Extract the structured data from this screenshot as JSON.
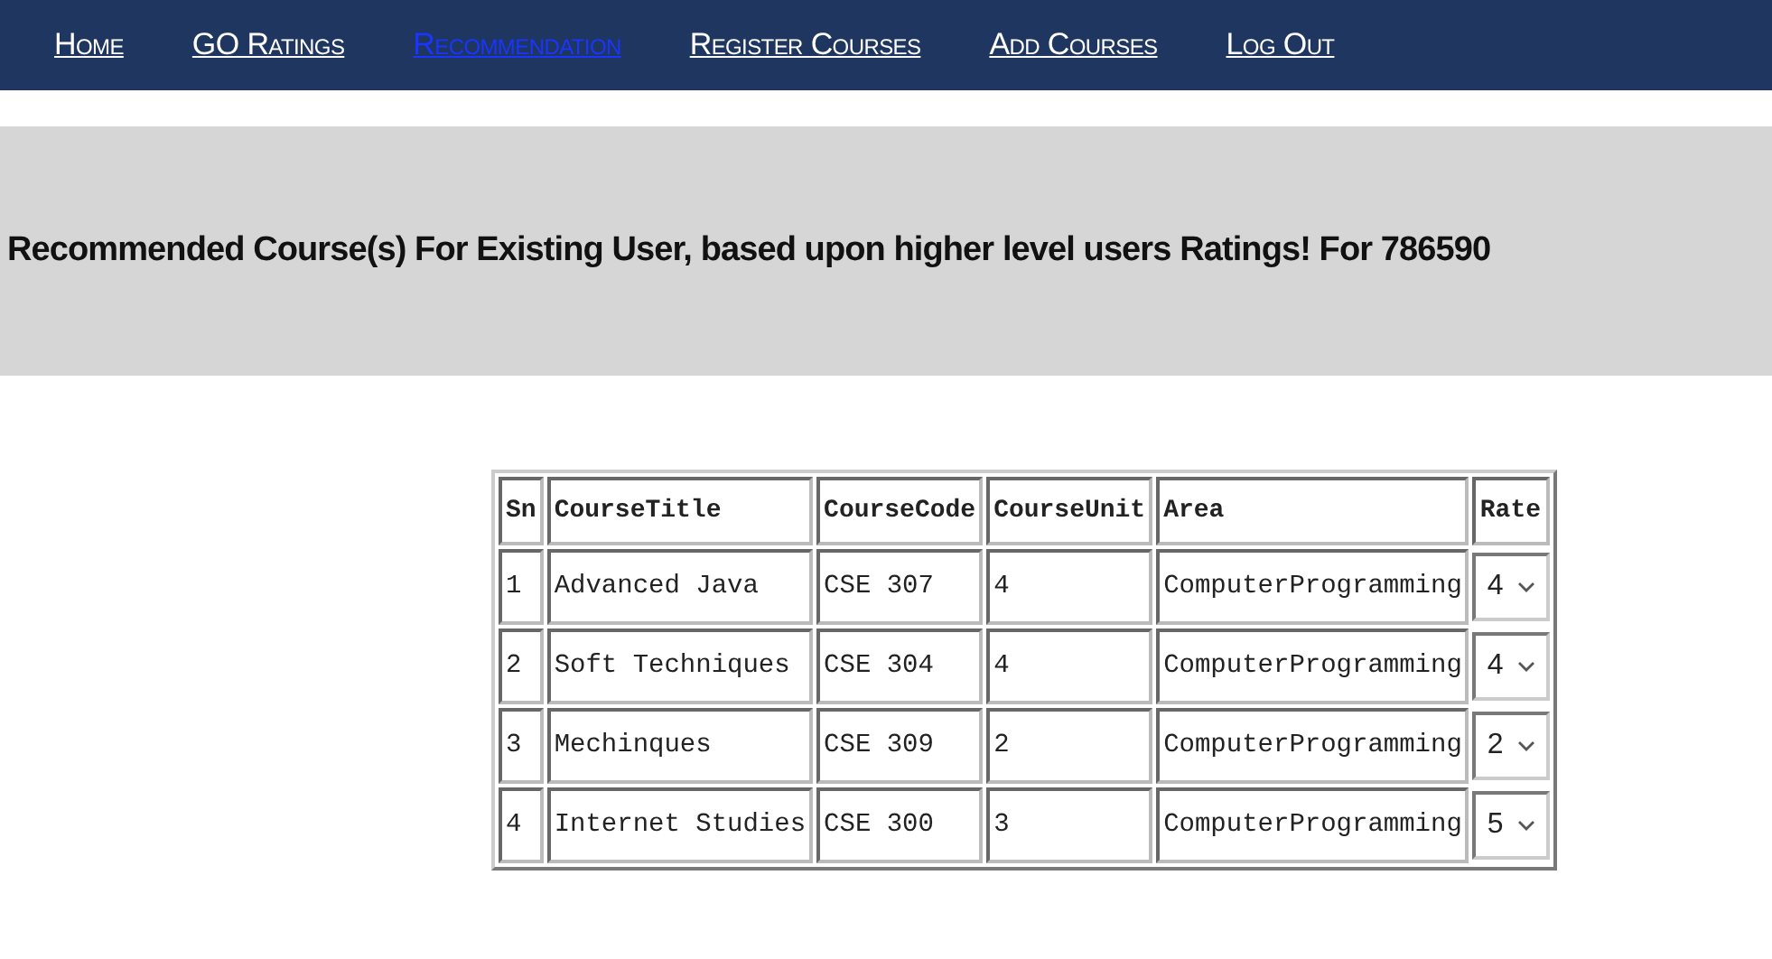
{
  "nav": [
    {
      "label": "Home",
      "selected": false
    },
    {
      "label": "GO Ratings",
      "selected": false
    },
    {
      "label": "Recommendation",
      "selected": true
    },
    {
      "label": "Register Courses",
      "selected": false
    },
    {
      "label": "Add Courses",
      "selected": false
    },
    {
      "label": "Log Out",
      "selected": false
    }
  ],
  "heading": "Recommended Course(s) For Existing User, based upon higher level users Ratings! For 786590",
  "table": {
    "columns": [
      "Sn",
      "CourseTitle",
      "CourseCode",
      "CourseUnit",
      "Area",
      "Rate"
    ],
    "rows": [
      {
        "sn": "1",
        "title": "Advanced Java",
        "code": "CSE 307",
        "unit": "4",
        "area": "ComputerProgramming",
        "rate": "4"
      },
      {
        "sn": "2",
        "title": "Soft Techniques",
        "code": "CSE 304",
        "unit": "4",
        "area": "ComputerProgramming",
        "rate": "4"
      },
      {
        "sn": "3",
        "title": "Mechinques",
        "code": "CSE 309",
        "unit": "2",
        "area": "ComputerProgramming",
        "rate": "2"
      },
      {
        "sn": "4",
        "title": "Internet Studies",
        "code": "CSE 300",
        "unit": "3",
        "area": "ComputerProgramming",
        "rate": "5"
      }
    ]
  }
}
